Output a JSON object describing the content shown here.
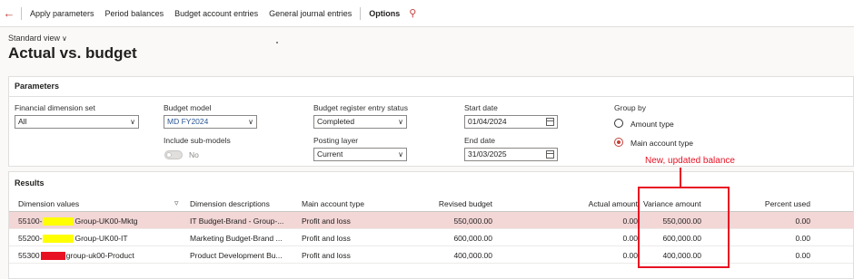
{
  "toolbar": {
    "back_icon": "back-arrow-icon",
    "items": [
      "Apply parameters",
      "Period balances",
      "Budget account entries",
      "General journal entries",
      "Options"
    ],
    "search_icon": "search-icon"
  },
  "page": {
    "view": "Standard view",
    "title": "Actual vs. budget"
  },
  "parameters": {
    "title": "Parameters",
    "financial_dimension_set": {
      "label": "Financial dimension set",
      "value": "All"
    },
    "budget_model": {
      "label": "Budget model",
      "value": "MD FY2024"
    },
    "include_sub_models": {
      "label": "Include sub-models",
      "value": "No"
    },
    "budget_register_entry_status": {
      "label": "Budget register entry status",
      "value": "Completed"
    },
    "posting_layer": {
      "label": "Posting layer",
      "value": "Current"
    },
    "start_date": {
      "label": "Start date",
      "value": "01/04/2024"
    },
    "end_date": {
      "label": "End date",
      "value": "31/03/2025"
    },
    "group_by": {
      "label": "Group by",
      "options": [
        {
          "label": "Amount type",
          "selected": false
        },
        {
          "label": "Main account type",
          "selected": true
        }
      ]
    }
  },
  "results": {
    "title": "Results",
    "columns": [
      "Dimension values",
      "Dimension descriptions",
      "Main account type",
      "Revised budget",
      "Actual amount",
      "Variance amount",
      "Percent used"
    ],
    "rows": [
      {
        "dim_prefix": "55100-",
        "dim_suffix": "Group-UK00-Mktg",
        "mask_color": "yellow",
        "description": "IT Budget-Brand - Group-...",
        "account_type": "Profit and loss",
        "revised_budget": "550,000.00",
        "actual": "0.00",
        "variance": "550,000.00",
        "percent": "0.00"
      },
      {
        "dim_prefix": "55200-",
        "dim_suffix": "Group-UK00-IT",
        "mask_color": "yellow",
        "description": "Marketing Budget-Brand ...",
        "account_type": "Profit and loss",
        "revised_budget": "600,000.00",
        "actual": "0.00",
        "variance": "600,000.00",
        "percent": "0.00"
      },
      {
        "dim_prefix": "55300",
        "dim_suffix": "group-uk00-Product",
        "mask_color": "red",
        "description": "Product Development Bu...",
        "account_type": "Profit and loss",
        "revised_budget": "400,000.00",
        "actual": "0.00",
        "variance": "400,000.00",
        "percent": "0.00"
      }
    ]
  },
  "annotation": {
    "text": "New, updated balance",
    "color": "#e81123"
  }
}
